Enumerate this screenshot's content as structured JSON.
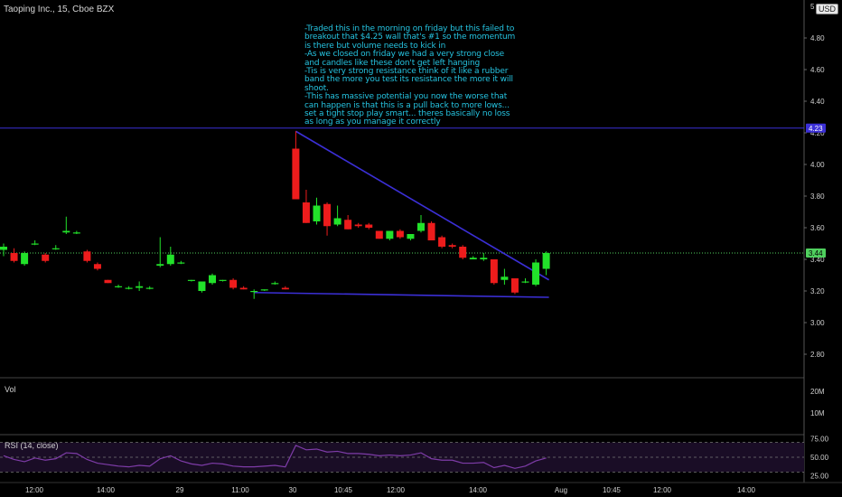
{
  "header": {
    "symbol_label": "Taoping Inc., 15, Cboe BZX",
    "currency_label": "USD"
  },
  "annotation": {
    "text": "-Traded this in the morning on friday but this failed to breakout that $4.25 wall that's #1 so the momentum is there but volume needs to kick in\n-As we closed on friday we had a very strong close and candles like these don't get left hanging\n-Tis is very strong resistance think of it like a rubber band the more you test its resistance the more it will shoot.\n-This has massive potential you now the worse that can happen is that this is a pull back to more lows... set a tight stop play smart... theres basically no loss as long as you manage it correctly"
  },
  "panes": {
    "volume_label": "Vol",
    "rsi_label": "RSI (14, close)"
  },
  "colors": {
    "up": "#22e22a",
    "down": "#ee1c1c",
    "trendline": "#3b2fd6",
    "rsi": "#7e3ca8",
    "rsi_band": "#1a0d26",
    "current_price": "#4fd05e",
    "resistance_tag": "#3b2fd6"
  },
  "chart_data": [
    {
      "type": "candlestick",
      "title": "Taoping Inc., 15, Cboe BZX",
      "ylim": [
        2.62,
        5.0
      ],
      "y_ticks": [
        "4.80",
        "4.60",
        "4.40",
        "4.20",
        "4.00",
        "3.80",
        "3.60",
        "3.40",
        "3.20",
        "3.00",
        "2.80"
      ],
      "x_tick_labels": [
        "12:00",
        "14:00",
        "29",
        "11:00",
        "30",
        "10:45",
        "12:00",
        "14:00",
        "Aug",
        "10:45",
        "12:00",
        "14:00"
      ],
      "current_price": "3.44",
      "resistance_line": "4.23",
      "candles": [
        {
          "o": 3.46,
          "h": 3.5,
          "l": 3.42,
          "c": 3.48
        },
        {
          "o": 3.44,
          "h": 3.47,
          "l": 3.38,
          "c": 3.39
        },
        {
          "o": 3.37,
          "h": 3.45,
          "l": 3.36,
          "c": 3.44
        },
        {
          "o": 3.5,
          "h": 3.52,
          "l": 3.49,
          "c": 3.5
        },
        {
          "o": 3.43,
          "h": 3.44,
          "l": 3.38,
          "c": 3.39
        },
        {
          "o": 3.47,
          "h": 3.49,
          "l": 3.46,
          "c": 3.47
        },
        {
          "o": 3.57,
          "h": 3.67,
          "l": 3.56,
          "c": 3.58
        },
        {
          "o": 3.57,
          "h": 3.58,
          "l": 3.56,
          "c": 3.57
        },
        {
          "o": 3.45,
          "h": 3.46,
          "l": 3.38,
          "c": 3.39
        },
        {
          "o": 3.37,
          "h": 3.38,
          "l": 3.33,
          "c": 3.34
        },
        {
          "o": 3.27,
          "h": 3.27,
          "l": 3.25,
          "c": 3.25
        },
        {
          "o": 3.23,
          "h": 3.24,
          "l": 3.22,
          "c": 3.23
        },
        {
          "o": 3.22,
          "h": 3.23,
          "l": 3.21,
          "c": 3.22
        },
        {
          "o": 3.22,
          "h": 3.26,
          "l": 3.2,
          "c": 3.23
        },
        {
          "o": 3.22,
          "h": 3.23,
          "l": 3.21,
          "c": 3.22
        },
        {
          "o": 3.36,
          "h": 3.54,
          "l": 3.35,
          "c": 3.37
        },
        {
          "o": 3.37,
          "h": 3.48,
          "l": 3.36,
          "c": 3.43
        },
        {
          "o": 3.38,
          "h": 3.39,
          "l": 3.37,
          "c": 3.38
        },
        {
          "o": 3.27,
          "h": 3.27,
          "l": 3.26,
          "c": 3.27
        },
        {
          "o": 3.2,
          "h": 3.26,
          "l": 3.19,
          "c": 3.26
        },
        {
          "o": 3.25,
          "h": 3.31,
          "l": 3.24,
          "c": 3.3
        },
        {
          "o": 3.27,
          "h": 3.27,
          "l": 3.26,
          "c": 3.27
        },
        {
          "o": 3.27,
          "h": 3.28,
          "l": 3.21,
          "c": 3.22
        },
        {
          "o": 3.22,
          "h": 3.23,
          "l": 3.21,
          "c": 3.21
        },
        {
          "o": 3.2,
          "h": 3.21,
          "l": 3.15,
          "c": 3.2
        },
        {
          "o": 3.21,
          "h": 3.21,
          "l": 3.2,
          "c": 3.21
        },
        {
          "o": 3.25,
          "h": 3.26,
          "l": 3.24,
          "c": 3.25
        },
        {
          "o": 3.22,
          "h": 3.23,
          "l": 3.21,
          "c": 3.21
        },
        {
          "o": 4.1,
          "h": 4.21,
          "l": 3.78,
          "c": 3.78
        },
        {
          "o": 3.76,
          "h": 3.84,
          "l": 3.63,
          "c": 3.63
        },
        {
          "o": 3.64,
          "h": 3.79,
          "l": 3.62,
          "c": 3.74
        },
        {
          "o": 3.75,
          "h": 3.76,
          "l": 3.55,
          "c": 3.61
        },
        {
          "o": 3.62,
          "h": 3.74,
          "l": 3.61,
          "c": 3.66
        },
        {
          "o": 3.65,
          "h": 3.68,
          "l": 3.59,
          "c": 3.59
        },
        {
          "o": 3.62,
          "h": 3.63,
          "l": 3.6,
          "c": 3.61
        },
        {
          "o": 3.62,
          "h": 3.63,
          "l": 3.59,
          "c": 3.6
        },
        {
          "o": 3.58,
          "h": 3.58,
          "l": 3.53,
          "c": 3.53
        },
        {
          "o": 3.53,
          "h": 3.58,
          "l": 3.52,
          "c": 3.58
        },
        {
          "o": 3.58,
          "h": 3.59,
          "l": 3.53,
          "c": 3.54
        },
        {
          "o": 3.53,
          "h": 3.56,
          "l": 3.52,
          "c": 3.56
        },
        {
          "o": 3.58,
          "h": 3.68,
          "l": 3.57,
          "c": 3.63
        },
        {
          "o": 3.63,
          "h": 3.64,
          "l": 3.52,
          "c": 3.52
        },
        {
          "o": 3.54,
          "h": 3.55,
          "l": 3.47,
          "c": 3.48
        },
        {
          "o": 3.49,
          "h": 3.5,
          "l": 3.47,
          "c": 3.48
        },
        {
          "o": 3.48,
          "h": 3.49,
          "l": 3.4,
          "c": 3.41
        },
        {
          "o": 3.4,
          "h": 3.42,
          "l": 3.4,
          "c": 3.41
        },
        {
          "o": 3.4,
          "h": 3.44,
          "l": 3.39,
          "c": 3.41
        },
        {
          "o": 3.4,
          "h": 3.4,
          "l": 3.24,
          "c": 3.25
        },
        {
          "o": 3.27,
          "h": 3.34,
          "l": 3.24,
          "c": 3.29
        },
        {
          "o": 3.28,
          "h": 3.28,
          "l": 3.18,
          "c": 3.19
        },
        {
          "o": 3.26,
          "h": 3.28,
          "l": 3.25,
          "c": 3.26
        },
        {
          "o": 3.24,
          "h": 3.4,
          "l": 3.23,
          "c": 3.38
        },
        {
          "o": 3.34,
          "h": 3.45,
          "l": 3.3,
          "c": 3.44
        }
      ],
      "trendlines": [
        {
          "name": "descending-resistance",
          "from": {
            "candle": 28,
            "y": 4.21
          },
          "to": {
            "candle": 52,
            "y": 3.27
          }
        },
        {
          "name": "support",
          "from": {
            "candle": 24,
            "y": 3.19
          },
          "to": {
            "candle": 52,
            "y": 3.16
          }
        }
      ]
    },
    {
      "type": "bar",
      "title": "Vol",
      "y_ticks": [
        "20M",
        "10M"
      ],
      "ylim": [
        0,
        25
      ]
    },
    {
      "type": "line",
      "title": "RSI (14, close)",
      "ylim": [
        20,
        80
      ],
      "y_ticks": [
        "75.00",
        "50.00",
        "25.00"
      ],
      "bands": [
        30,
        70
      ],
      "midline": 50,
      "values": [
        52,
        47,
        44,
        49,
        46,
        48,
        56,
        55,
        47,
        42,
        40,
        38,
        37,
        39,
        38,
        48,
        52,
        45,
        41,
        39,
        42,
        41,
        38,
        37,
        37,
        38,
        39,
        37,
        66,
        60,
        61,
        57,
        58,
        55,
        55,
        54,
        52,
        53,
        52,
        53,
        56,
        48,
        46,
        46,
        42,
        42,
        43,
        36,
        39,
        35,
        38,
        45,
        49
      ]
    }
  ]
}
